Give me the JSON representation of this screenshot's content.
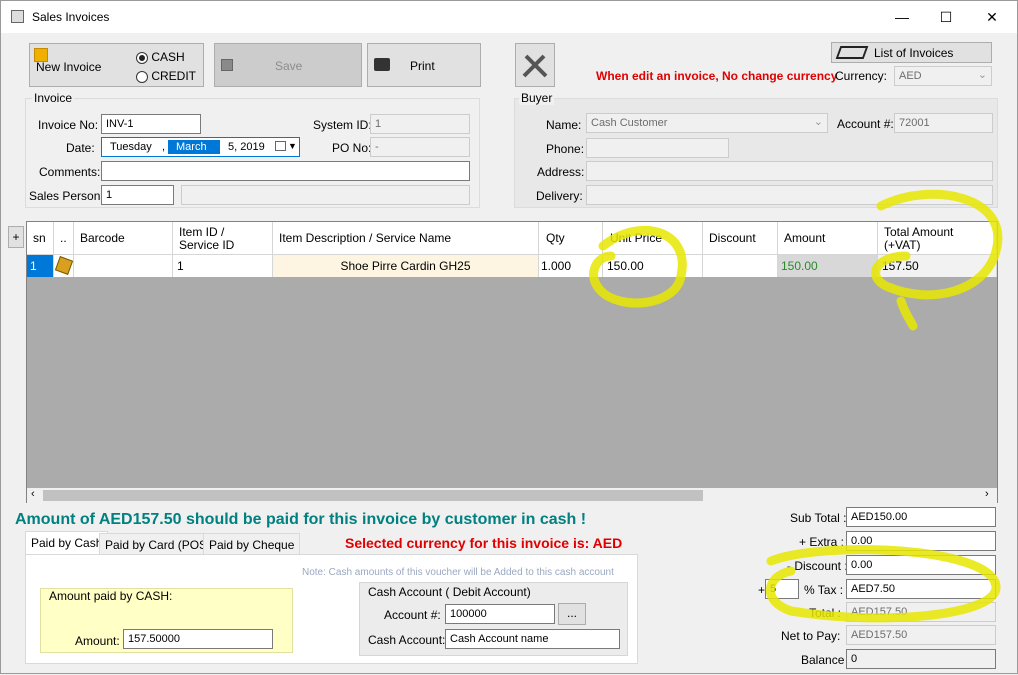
{
  "window": {
    "title": "Sales Invoices",
    "minimize": "—",
    "maximize": "☐",
    "close": "✕"
  },
  "toolbar": {
    "new_invoice": "New Invoice",
    "cash": "CASH",
    "credit": "CREDIT",
    "save": "Save",
    "print": "Print",
    "list_of_invoices": "List of Invoices",
    "warning": "When edit an invoice, No change currency",
    "currency_label": "Currency:",
    "currency_value": "AED"
  },
  "invoice": {
    "group_label": "Invoice",
    "invoice_no_label": "Invoice No:",
    "invoice_no": "INV-1",
    "system_id_label": "System ID:",
    "system_id": "1",
    "date_label": "Date:",
    "date_weekday": "Tuesday",
    "date_sep": ",",
    "date_month": "March",
    "date_dayyear": "5, 2019",
    "po_no_label": "PO No:",
    "po_no": "-",
    "comments_label": "Comments:",
    "comments": "",
    "sales_person_label": "Sales Person:",
    "sales_person": "1",
    "sales_person_name": ""
  },
  "buyer": {
    "group_label": "Buyer",
    "name_label": "Name:",
    "name": "Cash Customer",
    "account_label": "Account #:",
    "account": "72001",
    "phone_label": "Phone:",
    "phone": "",
    "address_label": "Address:",
    "address": "",
    "delivery_label": "Delivery:",
    "delivery": ""
  },
  "grid": {
    "plus": "+",
    "columns": [
      "sn",
      "..",
      "Barcode",
      "Item ID /\nService ID",
      "Item Description  / Service Name",
      "Qty",
      "Unit Price",
      "Discount",
      "Amount",
      "Total Amount\n(+VAT)"
    ],
    "rows": [
      {
        "sn": "1",
        "barcode": "",
        "item_id": "1",
        "description": "Shoe Pirre Cardin GH25",
        "qty": "1.000",
        "unit_price": "150.00",
        "discount": "",
        "amount": "150.00",
        "total": "157.50"
      }
    ]
  },
  "summary": {
    "message": "Amount of AED157.50 should be paid for this invoice by customer in cash !",
    "currency_message": "Selected currency for this invoice is: AED"
  },
  "tabs": [
    "Paid by Cash",
    "Paid by Card (POS)",
    "Paid by Cheque"
  ],
  "cash_panel": {
    "note": "Note: Cash amounts of this voucher will be Added to  this cash account",
    "amount_group": "Amount paid by CASH:",
    "amount_label": "Amount:",
    "amount": "157.50000",
    "cash_account_group": "Cash Account ( Debit Account)",
    "account_no_label": "Account #:",
    "account_no": "100000",
    "browse": "...",
    "cash_account_label": "Cash Account:",
    "cash_account": "Cash Account name"
  },
  "totals": {
    "subtotal_label": "Sub Total :",
    "subtotal": "AED150.00",
    "extra_label": "+ Extra :",
    "extra": "0.00",
    "discount_label": "- Discount :",
    "discount": "0.00",
    "tax_plus": "+",
    "tax_rate": "5",
    "tax_label": "% Tax :",
    "tax": "AED7.50",
    "total_label": "Total :",
    "total": "AED157.50",
    "net_label": "Net to Pay:",
    "net": "AED157.50",
    "balance_label": "Balance :",
    "balance": "0"
  },
  "colors": {
    "teal": "#008080",
    "red": "#e00000",
    "green": "#008000",
    "highlight": "#e6e600",
    "selection": "#0078d7"
  }
}
